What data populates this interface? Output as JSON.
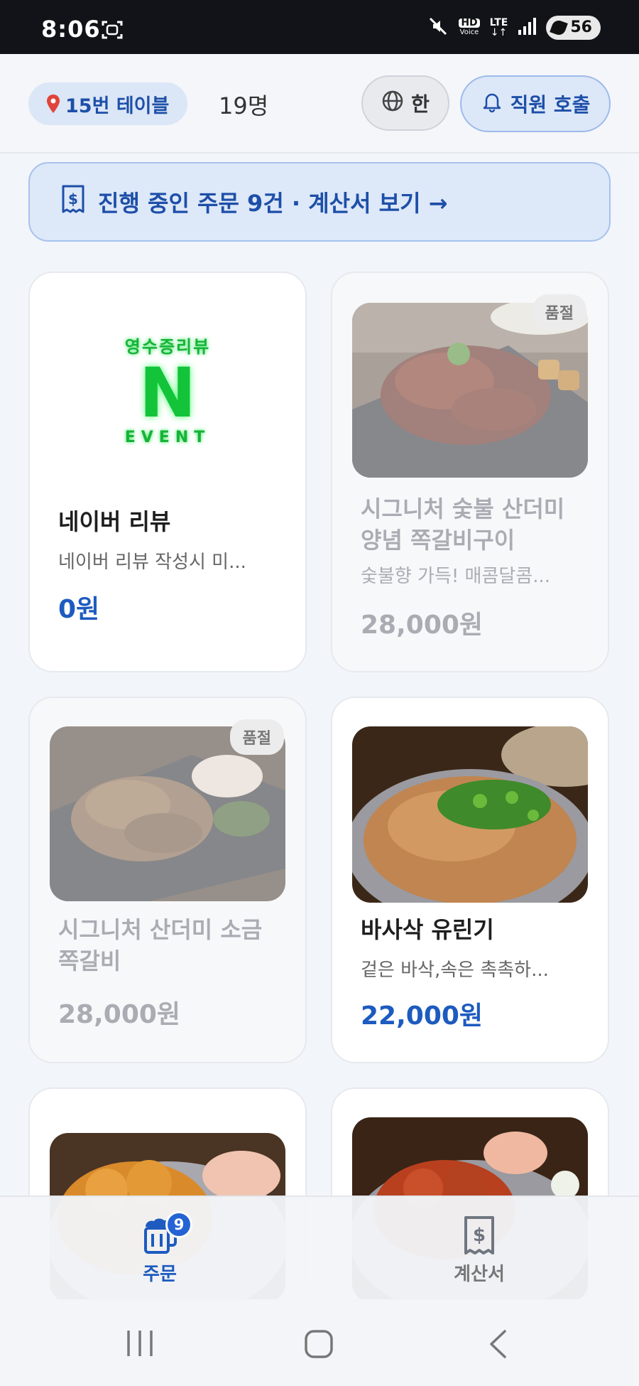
{
  "status_bar": {
    "time": "8:06",
    "network": "LTE",
    "hd_voice": "HD",
    "voice": "Voice",
    "battery": "56"
  },
  "header": {
    "table_label": "15번 테이블",
    "people_count": "19명",
    "language_label": "한",
    "call_staff_label": "직원 호출"
  },
  "order_banner": {
    "text": "진행 중인 주문 9건 · 계산서 보기 →"
  },
  "menu": {
    "soldout_label": "품절",
    "items": [
      {
        "name": "네이버 리뷰",
        "desc": "네이버 리뷰 작성시 미...",
        "price": "0원",
        "soldout": false,
        "img_text_top": "영수증리뷰",
        "img_text_n": "N",
        "img_text_bottom": "EVENT"
      },
      {
        "name": "시그니처 숯불 산더미 양념 쪽갈비구이",
        "desc": "숯불향 가득! 매콤달콤...",
        "price": "28,000원",
        "soldout": true
      },
      {
        "name": "시그니처 산더미 소금 쪽갈비",
        "desc": "",
        "price": "28,000원",
        "soldout": true
      },
      {
        "name": "바사삭 유린기",
        "desc": "겉은 바삭,속은 촉촉하...",
        "price": "22,000원",
        "soldout": false
      }
    ]
  },
  "bottom_nav": {
    "orders_label": "주문",
    "orders_badge": "9",
    "bill_label": "계산서"
  },
  "colors": {
    "accent": "#1d5bbf",
    "banner_bg": "#dde8f8",
    "soldout_text": "#a9adb3"
  }
}
